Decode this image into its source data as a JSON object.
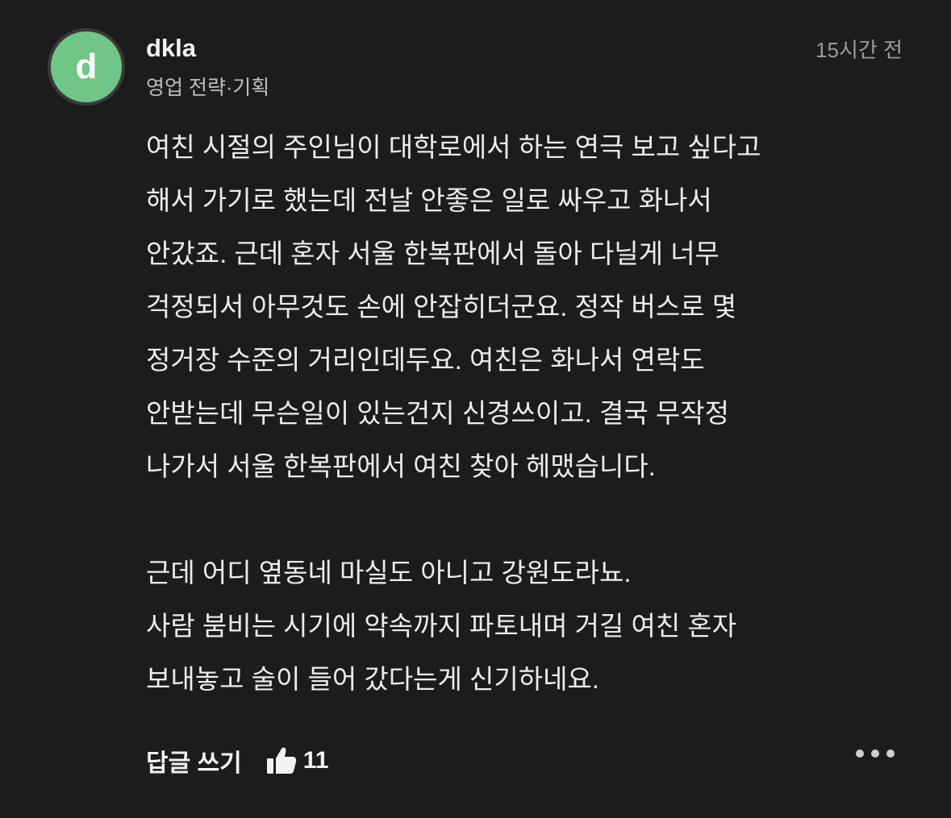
{
  "comment": {
    "avatar_letter": "d",
    "avatar_color": "#6fc686",
    "username": "dkla",
    "job": "영업 전략·기획",
    "time": "15시간 전",
    "paragraphs": [
      "여친 시절의 주인님이 대학로에서 하는 연극 보고 싶다고\n해서 가기로 했는데 전날 안좋은 일로 싸우고 화나서\n안갔죠. 근데 혼자 서울 한복판에서 돌아 다닐게 너무\n걱정되서 아무것도 손에 안잡히더군요. 정작 버스로 몇\n정거장 수준의 거리인데두요. 여친은 화나서 연락도\n안받는데 무슨일이 있는건지 신경쓰이고. 결국 무작정\n나가서 서울 한복판에서 여친 찾아 헤맸습니다.",
      "근데 어디 옆동네 마실도 아니고 강원도라뇨.\n사람 붐비는 시기에 약속까지 파토내며 거길 여친 혼자\n보내놓고 술이 들어 갔다는게 신기하네요."
    ]
  },
  "footer": {
    "reply_label": "답글 쓰기",
    "like_icon": "thumbs-up-icon",
    "like_count": "11",
    "more_icon": "more-icon"
  }
}
